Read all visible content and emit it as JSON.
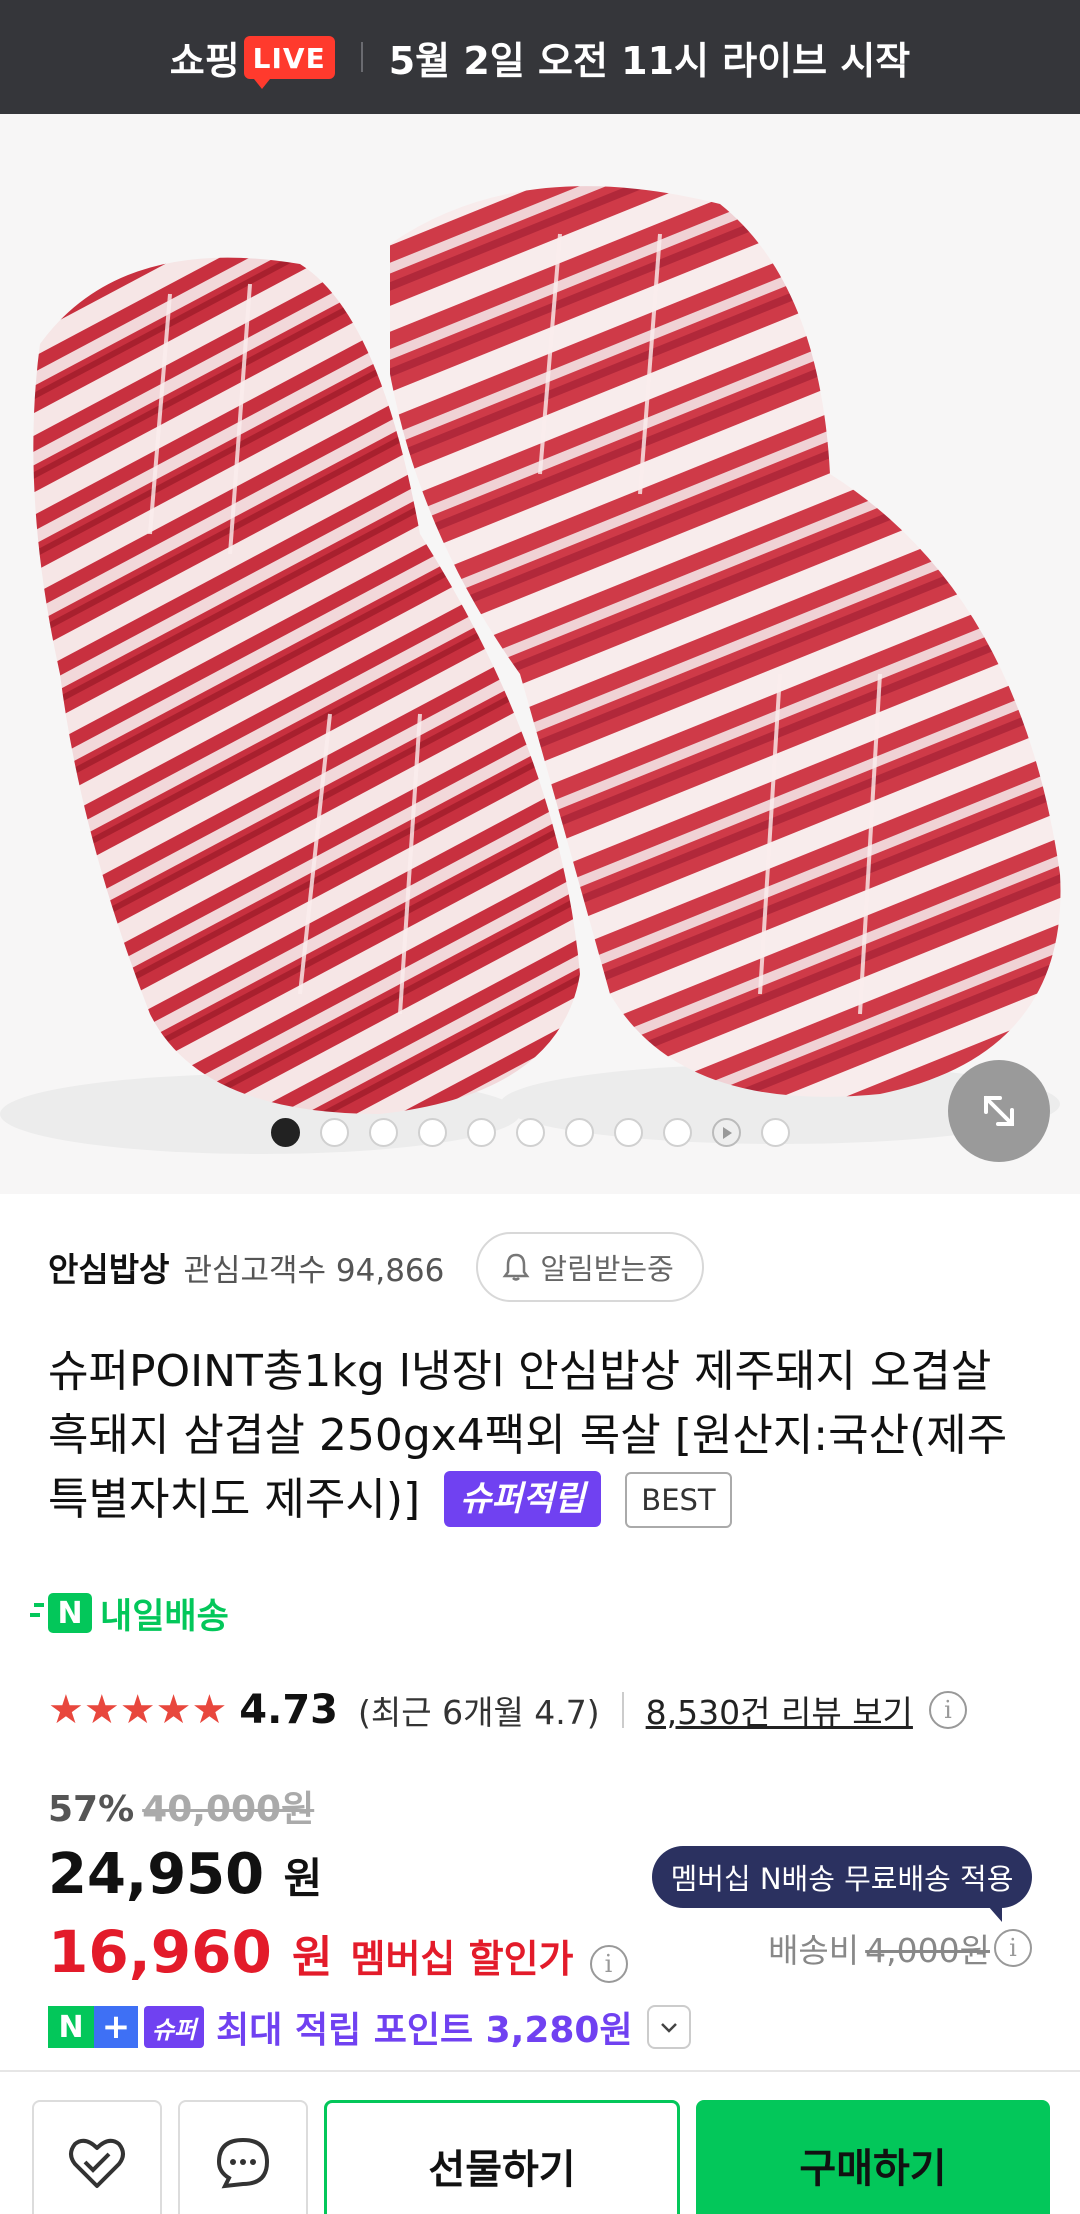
{
  "banner": {
    "brand": "쇼핑",
    "live_badge": "LIVE",
    "schedule": "5월 2일 오전 11시 라이브 시작"
  },
  "gallery": {
    "image_alt": "pork belly product photo",
    "dot_count": 11,
    "active_index": 0,
    "video_index": 9
  },
  "store": {
    "name": "안심밥상",
    "followers_label": "관심고객수 94,866",
    "notify_label": "알림받는중"
  },
  "product": {
    "title": "슈퍼POINT총1kg l냉장l 안심밥상 제주돼지 오겹살 흑돼지 삼겹살 250gx4팩외 목살 [원산지:국산(제주특별자치도 제주시)]",
    "super_badge": "슈퍼적립",
    "best_badge": "BEST",
    "delivery_label": "내일배송",
    "delivery_icon_letter": "N"
  },
  "rating": {
    "stars": "★★★★★",
    "value": "4.73",
    "recent": "(최근 6개월 4.7)",
    "reviews_link": "8,530건 리뷰 보기"
  },
  "price": {
    "discount_pct": "57%",
    "original": "40,000원",
    "sale": "24,950",
    "sale_unit": "원",
    "member": "16,960",
    "member_unit": "원",
    "member_label": "멤버십 할인가",
    "tooltip": "멤버십 N배송 무료배송 적용",
    "shipping_label": "배송비",
    "shipping_fee": "4,000원"
  },
  "points": {
    "n_letter": "N",
    "plus": "+",
    "super": "슈퍼",
    "text": "최대 적립 포인트 3,280원"
  },
  "actions": {
    "gift": "선물하기",
    "buy": "구매하기"
  },
  "colors": {
    "naver_green": "#03c75a",
    "super_purple": "#7041f1",
    "sale_red": "#e31b2a",
    "star_red": "#e8473d",
    "banner_bg": "#35363a"
  },
  "icons": [
    "bell-icon",
    "info-icon",
    "expand-icon",
    "chevron-down-icon",
    "heart-check-icon",
    "chat-icon"
  ]
}
